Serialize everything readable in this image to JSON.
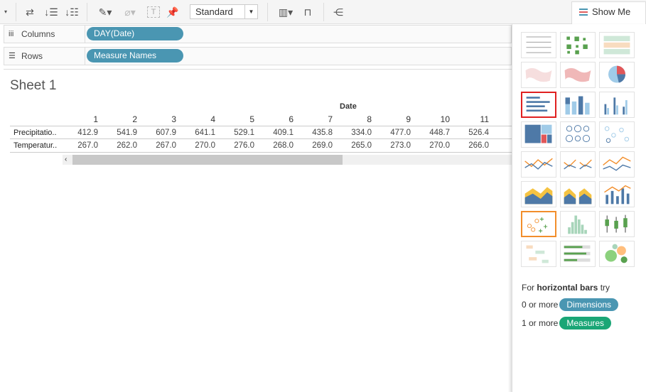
{
  "toolbar": {
    "mark_type": "Standard",
    "show_me_label": "Show Me"
  },
  "shelves": {
    "columns_label": "Columns",
    "columns_pill": "DAY(Date)",
    "rows_label": "Rows",
    "rows_pill": "Measure Names"
  },
  "sheet": {
    "title": "Sheet 1",
    "column_header": "Date",
    "columns": [
      "1",
      "2",
      "3",
      "4",
      "5",
      "6",
      "7",
      "8",
      "9",
      "10",
      "11"
    ],
    "rows": [
      {
        "label": "Precipitatio..",
        "values": [
          "412.9",
          "541.9",
          "607.9",
          "641.1",
          "529.1",
          "409.1",
          "435.8",
          "334.0",
          "477.0",
          "448.7",
          "526.4"
        ]
      },
      {
        "label": "Temperatur..",
        "values": [
          "267.0",
          "262.0",
          "267.0",
          "270.0",
          "276.0",
          "268.0",
          "269.0",
          "265.0",
          "273.0",
          "270.0",
          "266.0"
        ]
      }
    ]
  },
  "show_me": {
    "hint_prefix": "For",
    "hint_chart": "horizontal bars",
    "hint_suffix": "try",
    "dim_prefix": "0 or more",
    "dim_label": "Dimensions",
    "meas_prefix": "1 or more",
    "meas_label": "Measures",
    "colors": {
      "dimensions": "#4a96b2",
      "measures": "#1aa676",
      "selected": "#e02020"
    },
    "charts": [
      "text-table",
      "heat-map",
      "highlight-table",
      "symbol-map",
      "filled-map",
      "pie",
      "horizontal-bars",
      "stacked-bars",
      "side-by-side-bars",
      "treemap",
      "circle-views",
      "side-by-side-circles",
      "lines-continuous",
      "lines-discrete",
      "dual-lines",
      "area-continuous",
      "area-discrete",
      "dual-combination",
      "scatter-plot",
      "histogram",
      "box-and-whisker",
      "gantt",
      "bullet-graph",
      "packed-bubbles"
    ],
    "selected": "horizontal-bars"
  }
}
